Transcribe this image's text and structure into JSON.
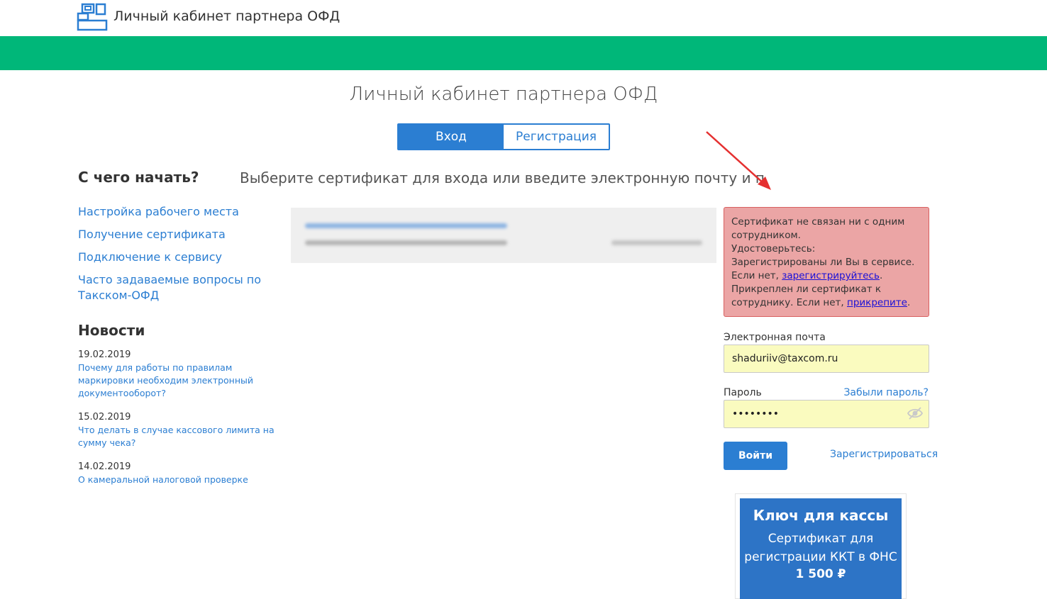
{
  "header": {
    "brand": "Личный кабинет партнера ОФД",
    "logo_icon": "cash-register-icon"
  },
  "colors": {
    "green_band": "#00b779",
    "primary_blue": "#2b7ed2",
    "alert_bg": "#eba5a5",
    "input_autofill": "#fafbbf"
  },
  "main": {
    "title": "Личный кабинет партнера ОФД",
    "tabs": [
      {
        "label": "Вход",
        "active": true
      },
      {
        "label": "Регистрация",
        "active": false
      }
    ],
    "subtitle": "Выберите сертификат для входа или введите электронную почту и пароль"
  },
  "sidebar": {
    "title": "С чего начать?",
    "links": [
      {
        "label": "Настройка рабочего места"
      },
      {
        "label": "Получение сертификата"
      },
      {
        "label": "Подключение к сервису"
      },
      {
        "label": "Часто задаваемые вопросы по Такском-ОФД"
      }
    ],
    "news_title": "Новости",
    "news": [
      {
        "date": "19.02.2019",
        "text": "Почему для работы по правилам маркировки необходим электронный документооборот?"
      },
      {
        "date": "15.02.2019",
        "text": "Что делать в случае кассового лимита на сумму чека?"
      },
      {
        "date": "14.02.2019",
        "text": "О камеральной налоговой проверке"
      }
    ]
  },
  "alert": {
    "line1": "Сертификат не связан ни с одним сотрудником.",
    "line2": "Удостоверьтесь:",
    "line3": "Зарегистрированы ли Вы в сервисе.",
    "line4_prefix": "Если нет, ",
    "line4_link": "зарегистрируйтесь",
    "line4_suffix": ".",
    "line5": "Прикреплен ли сертификат к сотруднику. Если нет, ",
    "line5_link": "прикрепите",
    "line5_suffix": "."
  },
  "login_form": {
    "email_label": "Электронная почта",
    "email_value": "shaduriiv@taxcom.ru",
    "password_label": "Пароль",
    "password_value": "••••••••",
    "forgot_label": "Забыли пароль?",
    "submit_label": "Войти",
    "register_label": "Зарегистрироваться"
  },
  "promo": {
    "title": "Ключ для кассы",
    "description": "Сертификат для регистрации ККТ в ФНС",
    "price": "1 500 ₽"
  }
}
